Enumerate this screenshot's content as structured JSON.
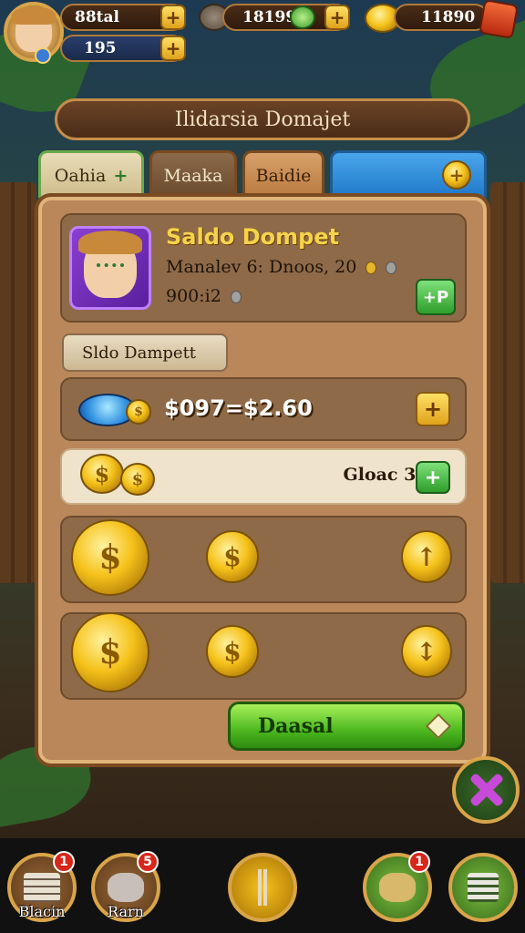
{
  "hud": {
    "player_value": "88tal",
    "player_sub_value": "195",
    "resource_value": "18199",
    "coins_value": "11890",
    "plus": "+"
  },
  "title": "Ilidarsia Domajet",
  "tabs": [
    {
      "label": "Oahia",
      "icon": "plus-icon"
    },
    {
      "label": "Maaka"
    },
    {
      "label": "Baidie"
    },
    {
      "label": "",
      "icon": "plus-icon"
    }
  ],
  "profile": {
    "name": "Saldo Dompet",
    "line2": "Manalev 6: Dnoos, 20",
    "line3": "900:i2"
  },
  "section_label": "Sldo Dampett",
  "balance": {
    "value": "$097=$2.60"
  },
  "total": {
    "label": "Gloac 385i"
  },
  "deposit_button": "Daasal",
  "bottom_nav": [
    {
      "label": "Blacin",
      "badge": "1",
      "icon": "books-icon"
    },
    {
      "label": "Rarn",
      "badge": "5",
      "icon": "ram-icon"
    },
    {
      "label": "",
      "badge": "",
      "icon": "tools-icon"
    },
    {
      "label": "",
      "badge": "1",
      "icon": "turtle-icon"
    },
    {
      "label": "",
      "badge": "",
      "icon": "list-icon"
    }
  ],
  "colors": {
    "gold": "#f5c21a",
    "panel": "#b9875a",
    "green_button": "#4cb81e",
    "badge_red": "#d8261a"
  }
}
